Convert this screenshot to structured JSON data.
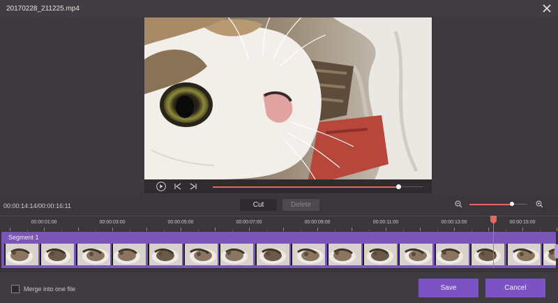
{
  "window": {
    "title": "20170228_211225.mp4"
  },
  "player": {
    "progress": 0.88
  },
  "info": {
    "timecode": "00:00:14:14/00:00:16:11",
    "cut_label": "Cut",
    "delete_label": "Delete",
    "zoom_level": 0.74
  },
  "ruler": {
    "labels": [
      "00:00:01:00",
      "00:00:03:00",
      "00:00:05:00",
      "00:00:07:00",
      "00:00:09:00",
      "00:00:11:00",
      "00:00:13:00",
      "00:00:15:00"
    ]
  },
  "timeline": {
    "segment_label": "Segment 1",
    "playhead_time": "00:00:14:14"
  },
  "footer": {
    "merge_label": "Merge into one file",
    "save_label": "Save",
    "cancel_label": "Cancel"
  },
  "colors": {
    "accent": "#7c53c3",
    "segment": "#7b56b9",
    "playhead": "#e8675d"
  }
}
